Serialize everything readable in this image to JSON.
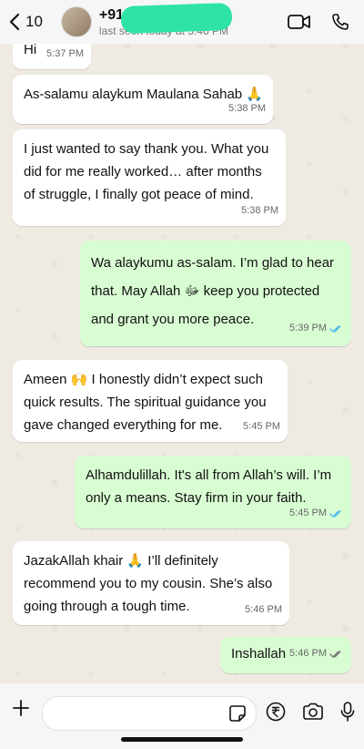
{
  "header": {
    "back_count": "10",
    "name": "+91",
    "status": "last seen today at 5:46 PM"
  },
  "messages": [
    {
      "text": "Hi",
      "time": "5:37 PM",
      "dir": "in"
    },
    {
      "text": "As-salamu alaykum Maulana Sahab 🙏",
      "time": "5:38 PM",
      "dir": "in"
    },
    {
      "text": "I just wanted to say thank you. What you did for me really worked… after months of struggle, I finally got peace of mind.",
      "time": "5:38 PM",
      "dir": "in"
    },
    {
      "text": "Wa alaykumu as-salam. I’m glad to hear that. May Allah ﷻ keep you protected and grant you more peace.",
      "time": "5:39 PM",
      "dir": "out"
    },
    {
      "text": "Ameen 🙌 I honestly didn’t expect such quick results. The spiritual guidance you gave changed everything for me.",
      "time": "5:45 PM",
      "dir": "in"
    },
    {
      "text": "Alhamdulillah. It's all from Allah’s will. I’m only a means. Stay firm in your faith.",
      "time": "5:45 PM",
      "dir": "out"
    },
    {
      "text": "JazakAllah khair 🙏 I’ll definitely recommend you to my cousin. She’s also going through a tough time.",
      "time": "5:46 PM",
      "dir": "in"
    },
    {
      "text": "Inshallah",
      "time": "5:46 PM",
      "dir": "out"
    }
  ],
  "icons": {
    "back": "chevron-left-icon",
    "video": "video-call-icon",
    "call": "phone-icon",
    "attach": "plus-icon",
    "sticker": "sticker-icon",
    "payment": "rupee-icon",
    "camera": "camera-icon",
    "mic": "microphone-icon"
  },
  "colors": {
    "background": "#efeae2",
    "incoming": "#ffffff",
    "outgoing": "#d9fdd3",
    "read_ticks": "#53bdeb"
  }
}
